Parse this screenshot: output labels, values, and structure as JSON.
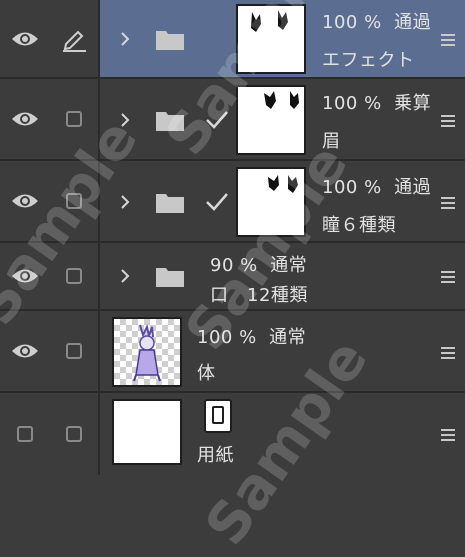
{
  "layers": [
    {
      "opacity": "100 %",
      "blend": "通過",
      "name": "エフェクト",
      "selected": true
    },
    {
      "opacity": "100 %",
      "blend": "乗算",
      "name": "眉"
    },
    {
      "opacity": "100 %",
      "blend": "通過",
      "name": "瞳６種類"
    },
    {
      "opacity": "90 %",
      "blend": "通常",
      "name": "口　12種類"
    },
    {
      "opacity": "100 %",
      "blend": "通常",
      "name": "体"
    },
    {
      "name": "用紙"
    }
  ],
  "watermark": "Sample",
  "colors": {
    "panel_bg": "#3c3c3c",
    "selected_bg": "#5b6e92",
    "divider": "#2a2a2a"
  }
}
